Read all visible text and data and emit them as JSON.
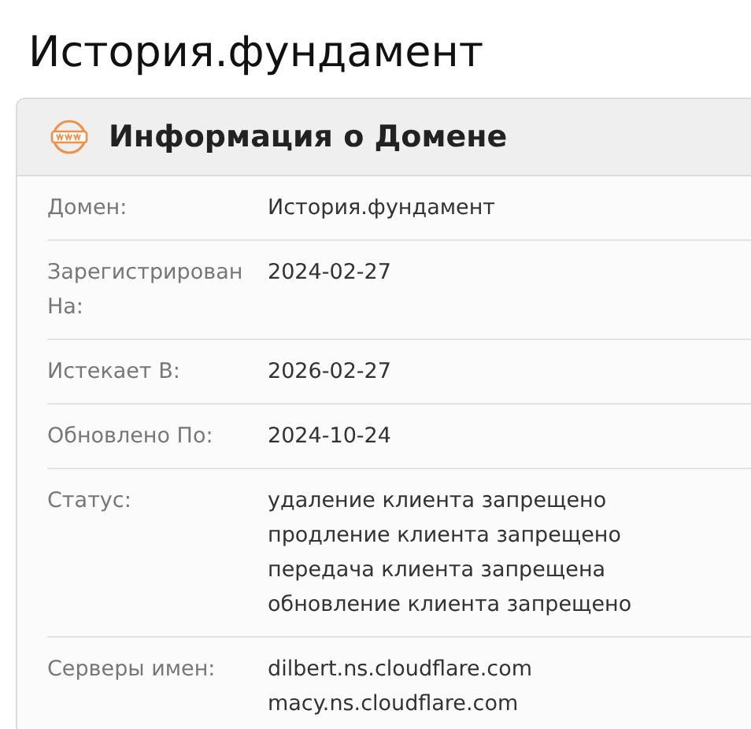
{
  "page_title": "История.фундамент",
  "card": {
    "title": "Информация о Домене",
    "rows": [
      {
        "label": "Домен:",
        "values": [
          "История.фундамент"
        ]
      },
      {
        "label": "Зарегистрирован На:",
        "values": [
          "2024-02-27"
        ]
      },
      {
        "label": "Истекает В:",
        "values": [
          "2026-02-27"
        ]
      },
      {
        "label": "Обновлено По:",
        "values": [
          "2024-10-24"
        ]
      },
      {
        "label": "Статус:",
        "values": [
          "удаление клиента запрещено",
          "продление клиента запрещено",
          "передача клиента запрещена",
          "обновление клиента запрещено"
        ]
      },
      {
        "label": "Серверы имен:",
        "values": [
          "dilbert.ns.cloudflare.com",
          "macy.ns.cloudflare.com"
        ]
      }
    ]
  }
}
